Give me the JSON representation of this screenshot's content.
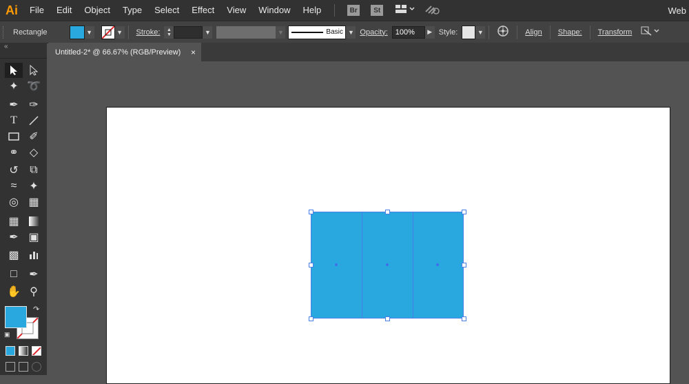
{
  "app": {
    "logo": "Ai",
    "workspace": "Web"
  },
  "menu": [
    "File",
    "Edit",
    "Object",
    "Type",
    "Select",
    "Effect",
    "View",
    "Window",
    "Help"
  ],
  "bridge": "Br",
  "stock": "St",
  "control": {
    "tool_name": "Rectangle",
    "stroke_label": "Stroke:",
    "brush_label": "Basic",
    "opacity_label": "Opacity:",
    "opacity_value": "100%",
    "style_label": "Style:",
    "align": "Align",
    "shape": "Shape:",
    "transform": "Transform",
    "fill_color": "#29a8e0"
  },
  "document": {
    "tab_title": "Untitled-2* @ 66.67% (RGB/Preview)",
    "close": "×"
  },
  "tools": [
    "selection-tool",
    "direct-selection-tool",
    "magic-wand-tool",
    "lasso-tool",
    "pen-tool",
    "curvature-tool",
    "type-tool",
    "line-tool",
    "rectangle-tool",
    "paintbrush-tool",
    "shaper-tool",
    "eraser-tool",
    "rotate-tool",
    "scale-tool",
    "width-tool",
    "puppet-warp-tool",
    "shape-builder-tool",
    "perspective-grid-tool",
    "mesh-tool",
    "gradient-tool",
    "eyedropper-tool",
    "blend-tool",
    "symbol-sprayer-tool",
    "column-graph-tool",
    "artboard-tool",
    "slice-tool",
    "hand-tool",
    "zoom-tool"
  ],
  "colors": {
    "fill": "#29a8e0",
    "accent": "#ff9a00",
    "selection": "#4a7fe8"
  }
}
